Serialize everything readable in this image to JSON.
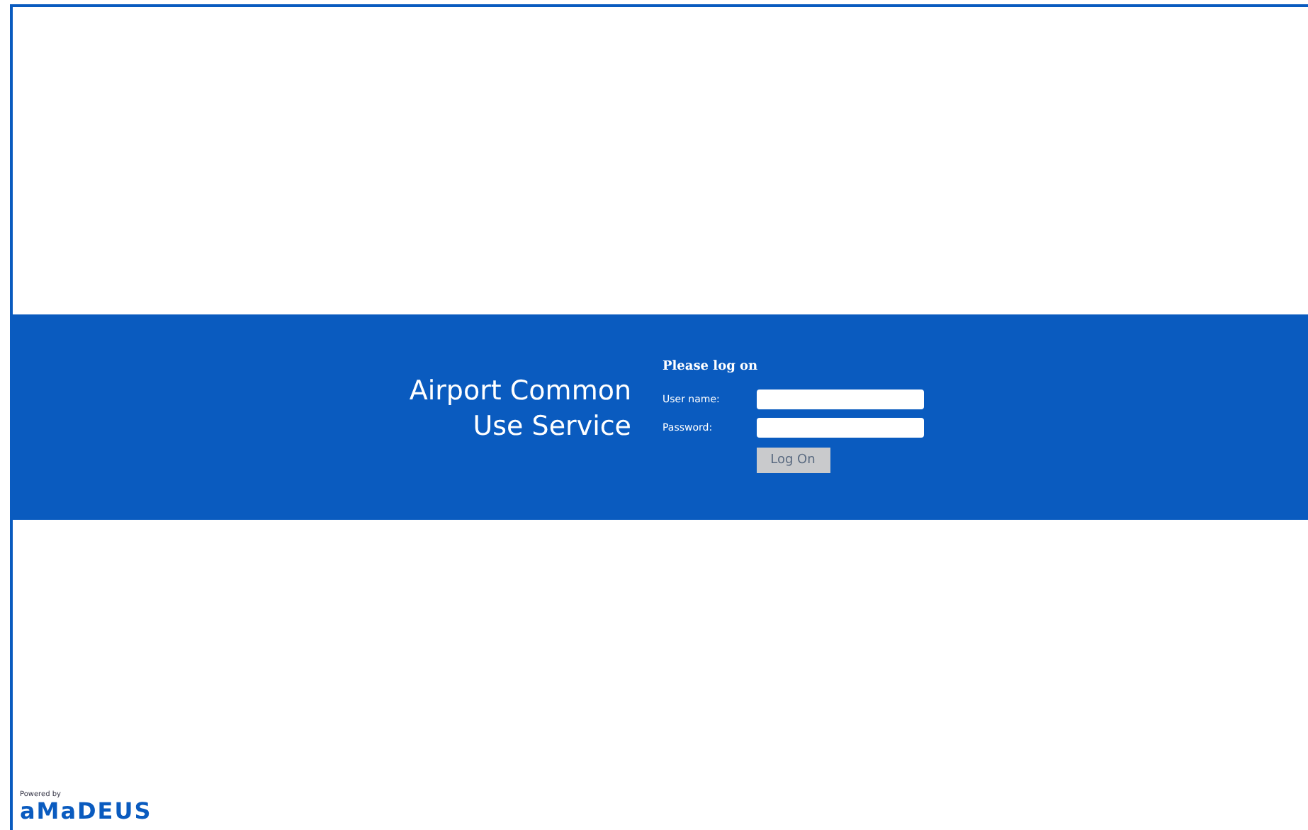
{
  "banner": {
    "title_lines": [
      "Airport Common",
      "Use Service"
    ]
  },
  "login": {
    "heading": "Please log on",
    "fields": [
      {
        "label": "User name:"
      },
      {
        "label": "Password:"
      }
    ],
    "button": "Log On"
  },
  "footer": {
    "powered_by": "Powered by",
    "logo": "aMaDEUS"
  }
}
